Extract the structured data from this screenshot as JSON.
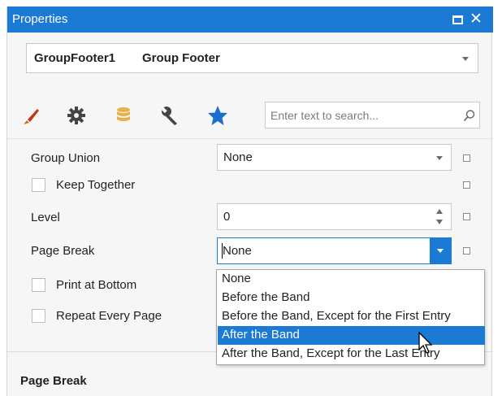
{
  "panel": {
    "title": "Properties"
  },
  "selector": {
    "name": "GroupFooter1",
    "type": "Group Footer"
  },
  "tabs": [
    {
      "icon": "brush-icon"
    },
    {
      "icon": "gear-icon"
    },
    {
      "icon": "database-icon"
    },
    {
      "icon": "wrench-icon"
    },
    {
      "icon": "star-icon"
    }
  ],
  "search": {
    "placeholder": "Enter text to search..."
  },
  "properties": {
    "group_union": {
      "label": "Group Union",
      "value": "None"
    },
    "keep_together": {
      "label": "Keep Together"
    },
    "level": {
      "label": "Level",
      "value": "0"
    },
    "page_break": {
      "label": "Page Break",
      "value": "None"
    },
    "print_at_bottom": {
      "label": "Print at Bottom"
    },
    "repeat_every_page": {
      "label": "Repeat Every Page"
    }
  },
  "dropdown": {
    "options": [
      "None",
      "Before the Band",
      "Before the Band, Except for the First Entry",
      "After the Band",
      "After the Band, Except for the Last Entry"
    ],
    "highlighted": "After the Band"
  },
  "description": {
    "title": "Page Break"
  },
  "colors": {
    "accent": "#1a7ad4",
    "brush": "#d46a1a",
    "database": "#e8b04a",
    "star": "#1a6fd0"
  }
}
